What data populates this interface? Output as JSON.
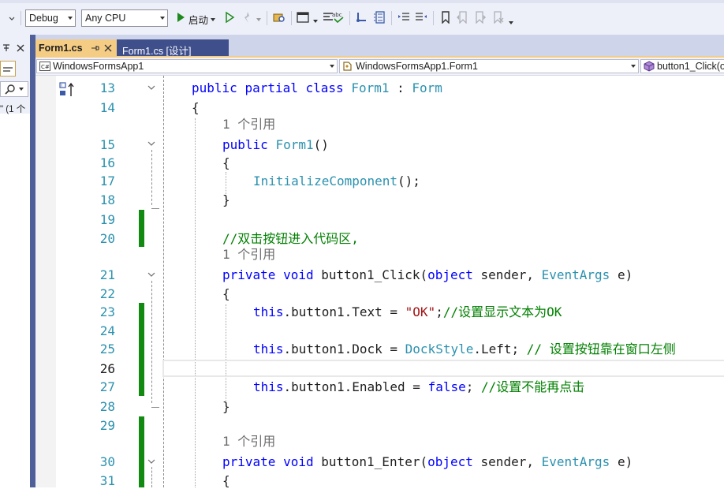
{
  "toolbar": {
    "configuration": "Debug",
    "platform": "Any CPU",
    "run_label": "启动",
    "icons": [
      "start-icon",
      "start-without-debug-icon",
      "hot-reload-icon",
      "browse-icon",
      "layout-icon",
      "spellcheck-icon",
      "step-icon",
      "bookmark-icon"
    ]
  },
  "tabs": [
    {
      "label": "Form1.cs",
      "active": true
    },
    {
      "label": "Form1.cs [设计]",
      "active": false
    }
  ],
  "nav": {
    "project": "WindowsFormsApp1",
    "class": "WindowsFormsApp1.Form1",
    "member": "button1_Click(o"
  },
  "left_panel": {
    "result_fragment": "\" (1 个"
  },
  "code_lines": [
    {
      "n": "13",
      "segs": [
        {
          "c": "kw",
          "t": "public"
        },
        {
          "c": "tx",
          "t": " "
        },
        {
          "c": "kw",
          "t": "partial"
        },
        {
          "c": "tx",
          "t": " "
        },
        {
          "c": "kw",
          "t": "class"
        },
        {
          "c": "tx",
          "t": " "
        },
        {
          "c": "ty",
          "t": "Form1"
        },
        {
          "c": "tx",
          "t": " : "
        },
        {
          "c": "ty",
          "t": "Form"
        }
      ]
    },
    {
      "n": "14",
      "segs": [
        {
          "c": "tx",
          "t": "{"
        }
      ]
    },
    {
      "n": "15",
      "refs": "1 个引用",
      "segs": [
        {
          "c": "kw",
          "t": "public"
        },
        {
          "c": "tx",
          "t": " "
        },
        {
          "c": "ty",
          "t": "Form1"
        },
        {
          "c": "tx",
          "t": "()"
        }
      ]
    },
    {
      "n": "16",
      "segs": [
        {
          "c": "tx",
          "t": "{"
        }
      ]
    },
    {
      "n": "17",
      "segs": [
        {
          "c": "ty",
          "t": "InitializeComponent"
        },
        {
          "c": "tx",
          "t": "();"
        }
      ]
    },
    {
      "n": "18",
      "segs": [
        {
          "c": "tx",
          "t": "}"
        }
      ]
    },
    {
      "n": "19",
      "segs": []
    },
    {
      "n": "20",
      "segs": [
        {
          "c": "cm",
          "t": "//双击按钮进入代码区,"
        }
      ]
    },
    {
      "n": "21",
      "refs": "1 个引用",
      "segs": [
        {
          "c": "kw",
          "t": "private"
        },
        {
          "c": "tx",
          "t": " "
        },
        {
          "c": "kw",
          "t": "void"
        },
        {
          "c": "tx",
          "t": " button1_Click("
        },
        {
          "c": "kw",
          "t": "object"
        },
        {
          "c": "tx",
          "t": " sender, "
        },
        {
          "c": "ty",
          "t": "EventArgs"
        },
        {
          "c": "tx",
          "t": " e)"
        }
      ]
    },
    {
      "n": "22",
      "segs": [
        {
          "c": "tx",
          "t": "{"
        }
      ]
    },
    {
      "n": "23",
      "segs": [
        {
          "c": "kw",
          "t": "this"
        },
        {
          "c": "tx",
          "t": ".button1.Text = "
        },
        {
          "c": "st",
          "t": "\"OK\""
        },
        {
          "c": "tx",
          "t": ";"
        },
        {
          "c": "cm",
          "t": "//设置显示文本为OK"
        }
      ]
    },
    {
      "n": "24",
      "segs": []
    },
    {
      "n": "25",
      "segs": [
        {
          "c": "kw",
          "t": "this"
        },
        {
          "c": "tx",
          "t": ".button1.Dock = "
        },
        {
          "c": "ty",
          "t": "DockStyle"
        },
        {
          "c": "tx",
          "t": ".Left; "
        },
        {
          "c": "cm",
          "t": "// 设置按钮靠在窗口左侧"
        }
      ]
    },
    {
      "n": "26",
      "segs": []
    },
    {
      "n": "27",
      "segs": [
        {
          "c": "kw",
          "t": "this"
        },
        {
          "c": "tx",
          "t": ".button1.Enabled = "
        },
        {
          "c": "kw",
          "t": "false"
        },
        {
          "c": "tx",
          "t": "; "
        },
        {
          "c": "cm",
          "t": "//设置不能再点击"
        }
      ]
    },
    {
      "n": "28",
      "segs": [
        {
          "c": "tx",
          "t": "}"
        }
      ]
    },
    {
      "n": "29",
      "segs": []
    },
    {
      "n": "30",
      "refs": "1 个引用",
      "segs": [
        {
          "c": "kw",
          "t": "private"
        },
        {
          "c": "tx",
          "t": " "
        },
        {
          "c": "kw",
          "t": "void"
        },
        {
          "c": "tx",
          "t": " button1_Enter("
        },
        {
          "c": "kw",
          "t": "object"
        },
        {
          "c": "tx",
          "t": " sender, "
        },
        {
          "c": "ty",
          "t": "EventArgs"
        },
        {
          "c": "tx",
          "t": " e)"
        }
      ]
    },
    {
      "n": "31",
      "segs": [
        {
          "c": "tx",
          "t": "{"
        }
      ]
    }
  ],
  "colors": {
    "keyword": "#0000ff",
    "type": "#2b91af",
    "string": "#a31515",
    "comment": "#008000",
    "line_number": "#2b91af",
    "change_marker": "#128a12",
    "active_tab": "#f5cc84",
    "inactive_tab": "#3f4f8c"
  }
}
